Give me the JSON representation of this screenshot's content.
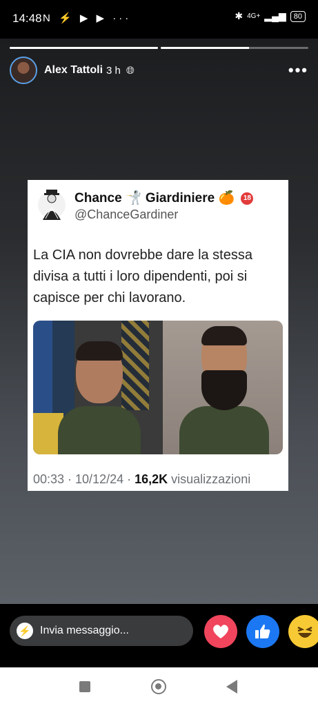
{
  "status_bar": {
    "time": "14:48",
    "left_icons": "N ⚡ ▶ ▶ ···",
    "network": "4G+",
    "battery": "80"
  },
  "story": {
    "progress": [
      1.0,
      0.6
    ],
    "author": "Alex Tattoli",
    "time_ago": "3 h",
    "globe_icon": "globe-icon",
    "more_icon": "more-icon"
  },
  "tweet": {
    "display_name": "Chance 🤺 Giardiniere 🍊",
    "badge": "18",
    "handle": "@ChanceGardiner",
    "text": "La CIA non dovrebbe dare la stessa divisa a tutti i loro dipendenti, poi si capisce per chi lavorano.",
    "meta_time": "00:33 · 10/12/24 · ",
    "meta_views_count": "16,2K",
    "meta_views_label": " visualizzazioni"
  },
  "reply_bar": {
    "placeholder": "Invia messaggio...",
    "reactions": [
      "love-reaction",
      "like-reaction",
      "haha-reaction"
    ]
  },
  "nav": {
    "buttons": [
      "recents-button",
      "home-button",
      "back-button"
    ]
  }
}
